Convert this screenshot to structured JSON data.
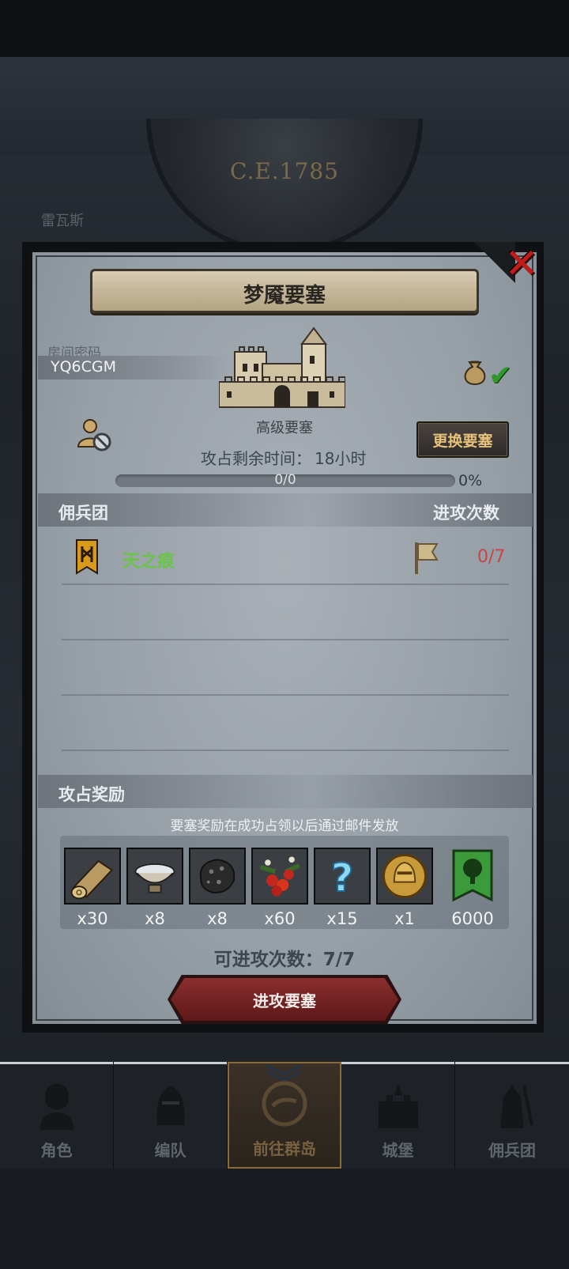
{
  "background": {
    "year": "C.E.1785",
    "city": "雷瓦斯"
  },
  "dialog": {
    "title": "梦魇要塞",
    "room_password_label": "房间密码",
    "room_password": "YQ6CGM",
    "fortress_level": "高级要塞",
    "change_fortress_label": "更换要塞",
    "time_remaining_label": "攻占剩余时间：",
    "time_remaining_value": "18小时",
    "progress_count": "0/0",
    "progress_percent": "0%",
    "progress_fraction": 0,
    "mercenary_header": "佣兵团",
    "attack_count_header": "进攻次数",
    "mercenaries": [
      {
        "name": "天之痕",
        "attacks": "0/7"
      }
    ],
    "rewards_header": "攻占奖励",
    "rewards_note": "要塞奖励在成功占领以后通过邮件发放",
    "rewards": [
      {
        "icon": "log-icon",
        "count": "x30"
      },
      {
        "icon": "bowl-icon",
        "count": "x8"
      },
      {
        "icon": "ore-icon",
        "count": "x8"
      },
      {
        "icon": "berries-icon",
        "count": "x60"
      },
      {
        "icon": "mystery-question-icon",
        "count": "x15"
      },
      {
        "icon": "knight-coin-icon",
        "count": "x1"
      },
      {
        "icon": "tree-banner-icon",
        "count": "6000"
      }
    ],
    "attempts_text": "可进攻次数：7/7",
    "attack_button_label": "进攻要塞"
  },
  "bottom_nav": [
    {
      "label": "角色"
    },
    {
      "label": "编队"
    },
    {
      "label": "前往群岛",
      "active": true
    },
    {
      "label": "城堡"
    },
    {
      "label": "佣兵团"
    }
  ],
  "colors": {
    "merc_name": "#6ac44a",
    "attack_count": "#c84545",
    "close": "#c41a1a",
    "attack_button": "#7a2424"
  }
}
